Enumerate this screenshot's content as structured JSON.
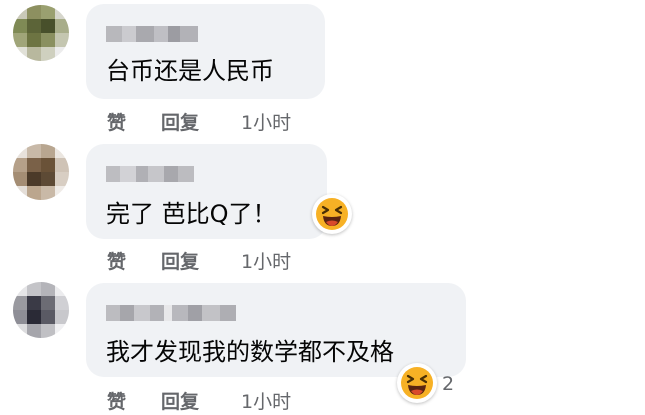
{
  "comments": [
    {
      "text": "台币还是人民币",
      "actions": {
        "like": "赞",
        "reply": "回复",
        "time": "1小时"
      }
    },
    {
      "text": "完了 芭比Q了！",
      "actions": {
        "like": "赞",
        "reply": "回复",
        "time": "1小时"
      },
      "reaction": {
        "icon": "laughing-emoji-icon"
      }
    },
    {
      "text": "我才发现我的数学都不及格",
      "actions": {
        "like": "赞",
        "reply": "回复",
        "time": "1小时"
      },
      "reaction": {
        "icon": "laughing-emoji-icon",
        "count": "2"
      }
    }
  ],
  "colors": {
    "bubble": "#f0f2f5",
    "text": "#050505",
    "meta": "#65676b",
    "emoji_face": "#f7b125",
    "emoji_mouth": "#d94a2b"
  }
}
